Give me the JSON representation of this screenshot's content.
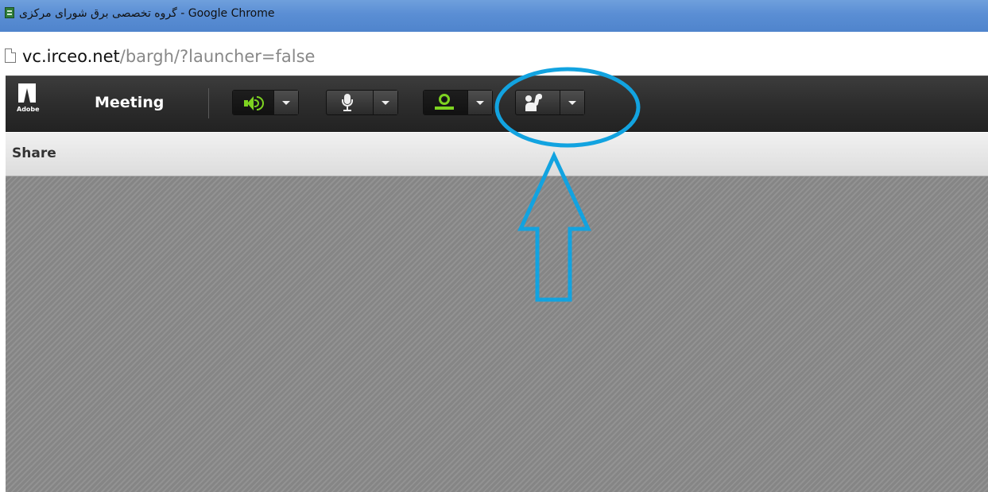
{
  "browser": {
    "window_title": "گروه تخصصی برق شورای مرکزی - Google Chrome",
    "url_host": "vc.irceo.net",
    "url_path": "/bargh/?launcher=false"
  },
  "toolbar": {
    "logo_text": "Adobe",
    "meeting_menu_label": "Meeting",
    "controls": [
      {
        "name": "speaker",
        "icon": "speaker-icon",
        "state": "on",
        "color": "#7ed321"
      },
      {
        "name": "microphone",
        "icon": "microphone-icon",
        "state": "off"
      },
      {
        "name": "webcam",
        "icon": "webcam-icon",
        "state": "on",
        "color": "#7ed321"
      },
      {
        "name": "raise-hand",
        "icon": "raise-hand-icon",
        "state": "off"
      }
    ]
  },
  "share_pod": {
    "title": "Share"
  },
  "annotation": {
    "color": "#12a3e0",
    "shapes": [
      "ellipse-highlight",
      "up-arrow"
    ]
  }
}
